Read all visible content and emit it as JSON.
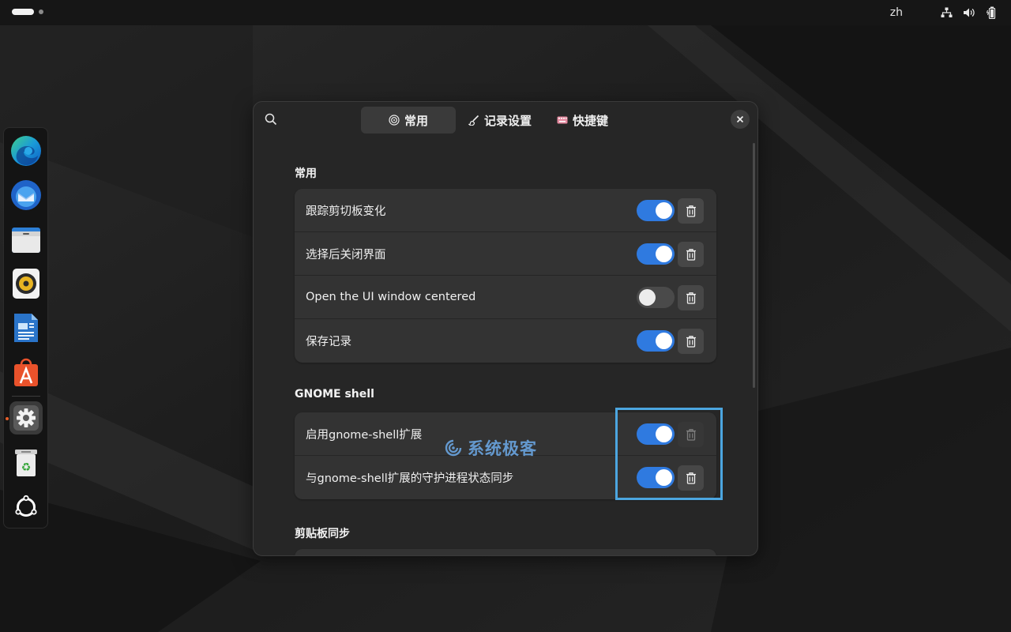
{
  "topbar": {
    "language": "zh"
  },
  "dock": {
    "items": [
      {
        "name": "edge-browser"
      },
      {
        "name": "thunderbird"
      },
      {
        "name": "files"
      },
      {
        "name": "rhythmbox"
      },
      {
        "name": "libreoffice-writer"
      },
      {
        "name": "app-center"
      },
      {
        "name": "settings"
      },
      {
        "name": "trash"
      },
      {
        "name": "show-apps"
      }
    ]
  },
  "window": {
    "tabs": [
      {
        "label": "常用",
        "icon": "target-icon"
      },
      {
        "label": "记录设置",
        "icon": "brush-icon"
      },
      {
        "label": "快捷键",
        "icon": "keyboard-icon"
      }
    ],
    "sections": [
      {
        "title": "常用",
        "rows": [
          {
            "label": "跟踪剪切板变化",
            "on": true
          },
          {
            "label": "选择后关闭界面",
            "on": true
          },
          {
            "label": "Open the UI window centered",
            "on": false
          },
          {
            "label": "保存记录",
            "on": true
          }
        ]
      },
      {
        "title": "GNOME shell",
        "rows": [
          {
            "label": "启用gnome-shell扩展",
            "on": true
          },
          {
            "label": "与gnome-shell扩展的守护进程状态同步",
            "on": true
          }
        ]
      },
      {
        "title": "剪贴板同步",
        "rows": []
      }
    ]
  },
  "watermark": {
    "text": "系统极客"
  },
  "colors": {
    "accent": "#2f7ae0",
    "highlight": "#4ca6e0"
  }
}
